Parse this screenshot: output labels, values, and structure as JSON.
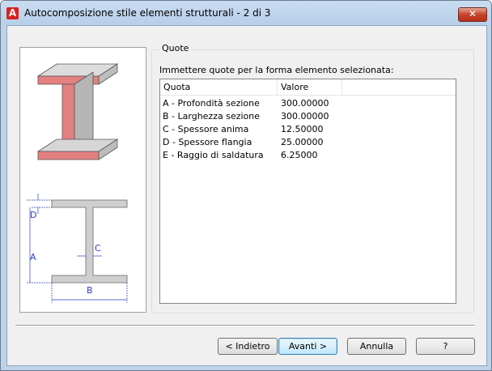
{
  "window": {
    "title": "Autocomposizione stile elementi strutturali - 2 di 3",
    "close_symbol": "✕",
    "app_icon_letter": "A"
  },
  "illustration": {
    "dim_labels": {
      "a": "A",
      "b": "B",
      "c": "C",
      "d": "D"
    },
    "colors": {
      "flange_highlight": "#e06060",
      "dimension": "#2b3dbf",
      "section": "#cfcfcf"
    }
  },
  "group": {
    "label": "Quote",
    "instruction": "Immettere quote per la forma elemento selezionata:"
  },
  "table": {
    "headers": [
      "Quota",
      "Valore"
    ],
    "rows": [
      [
        "A - Profondità sezione",
        "300.00000"
      ],
      [
        "B - Larghezza sezione",
        "300.00000"
      ],
      [
        "C - Spessore anima",
        "12.50000"
      ],
      [
        "D - Spessore flangia",
        "25.00000"
      ],
      [
        "E - Raggio di saldatura",
        "6.25000"
      ]
    ]
  },
  "buttons": {
    "back": {
      "label": "< Indietro"
    },
    "next": {
      "label": "Avanti >"
    },
    "cancel": {
      "label": "Annulla"
    },
    "help": {
      "label": "?"
    }
  }
}
